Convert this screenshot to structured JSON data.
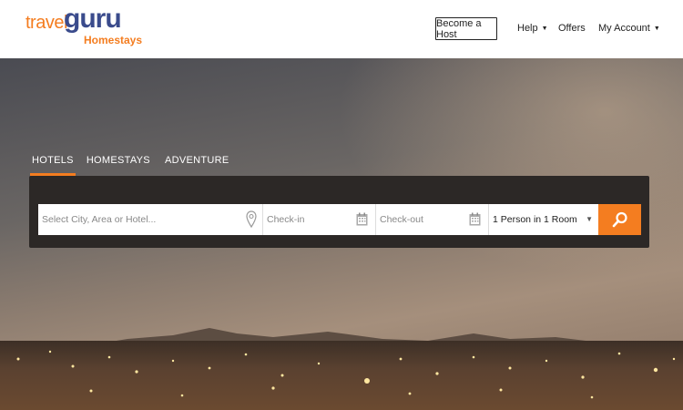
{
  "brand": {
    "name_part1": "travel",
    "name_part2": "guru",
    "sub": "Homestays"
  },
  "nav": {
    "become_host": "Become a Host",
    "help": "Help",
    "offers": "Offers",
    "my_account": "My Account"
  },
  "tabs": [
    {
      "label": "HOTELS",
      "active": true
    },
    {
      "label": "HOMESTAYS",
      "active": false
    },
    {
      "label": "ADVENTURE",
      "active": false
    }
  ],
  "search": {
    "city_placeholder": "Select City, Area or Hotel...",
    "checkin_placeholder": "Check-in",
    "checkout_placeholder": "Check-out",
    "guests_value": "1 Person in 1 Room"
  },
  "colors": {
    "accent": "#f47d20",
    "brand_blue": "#3a4b8c",
    "panel": "#2c2826"
  },
  "icons": [
    "map-pin-icon",
    "calendar-icon",
    "search-icon",
    "caret-down-icon"
  ]
}
